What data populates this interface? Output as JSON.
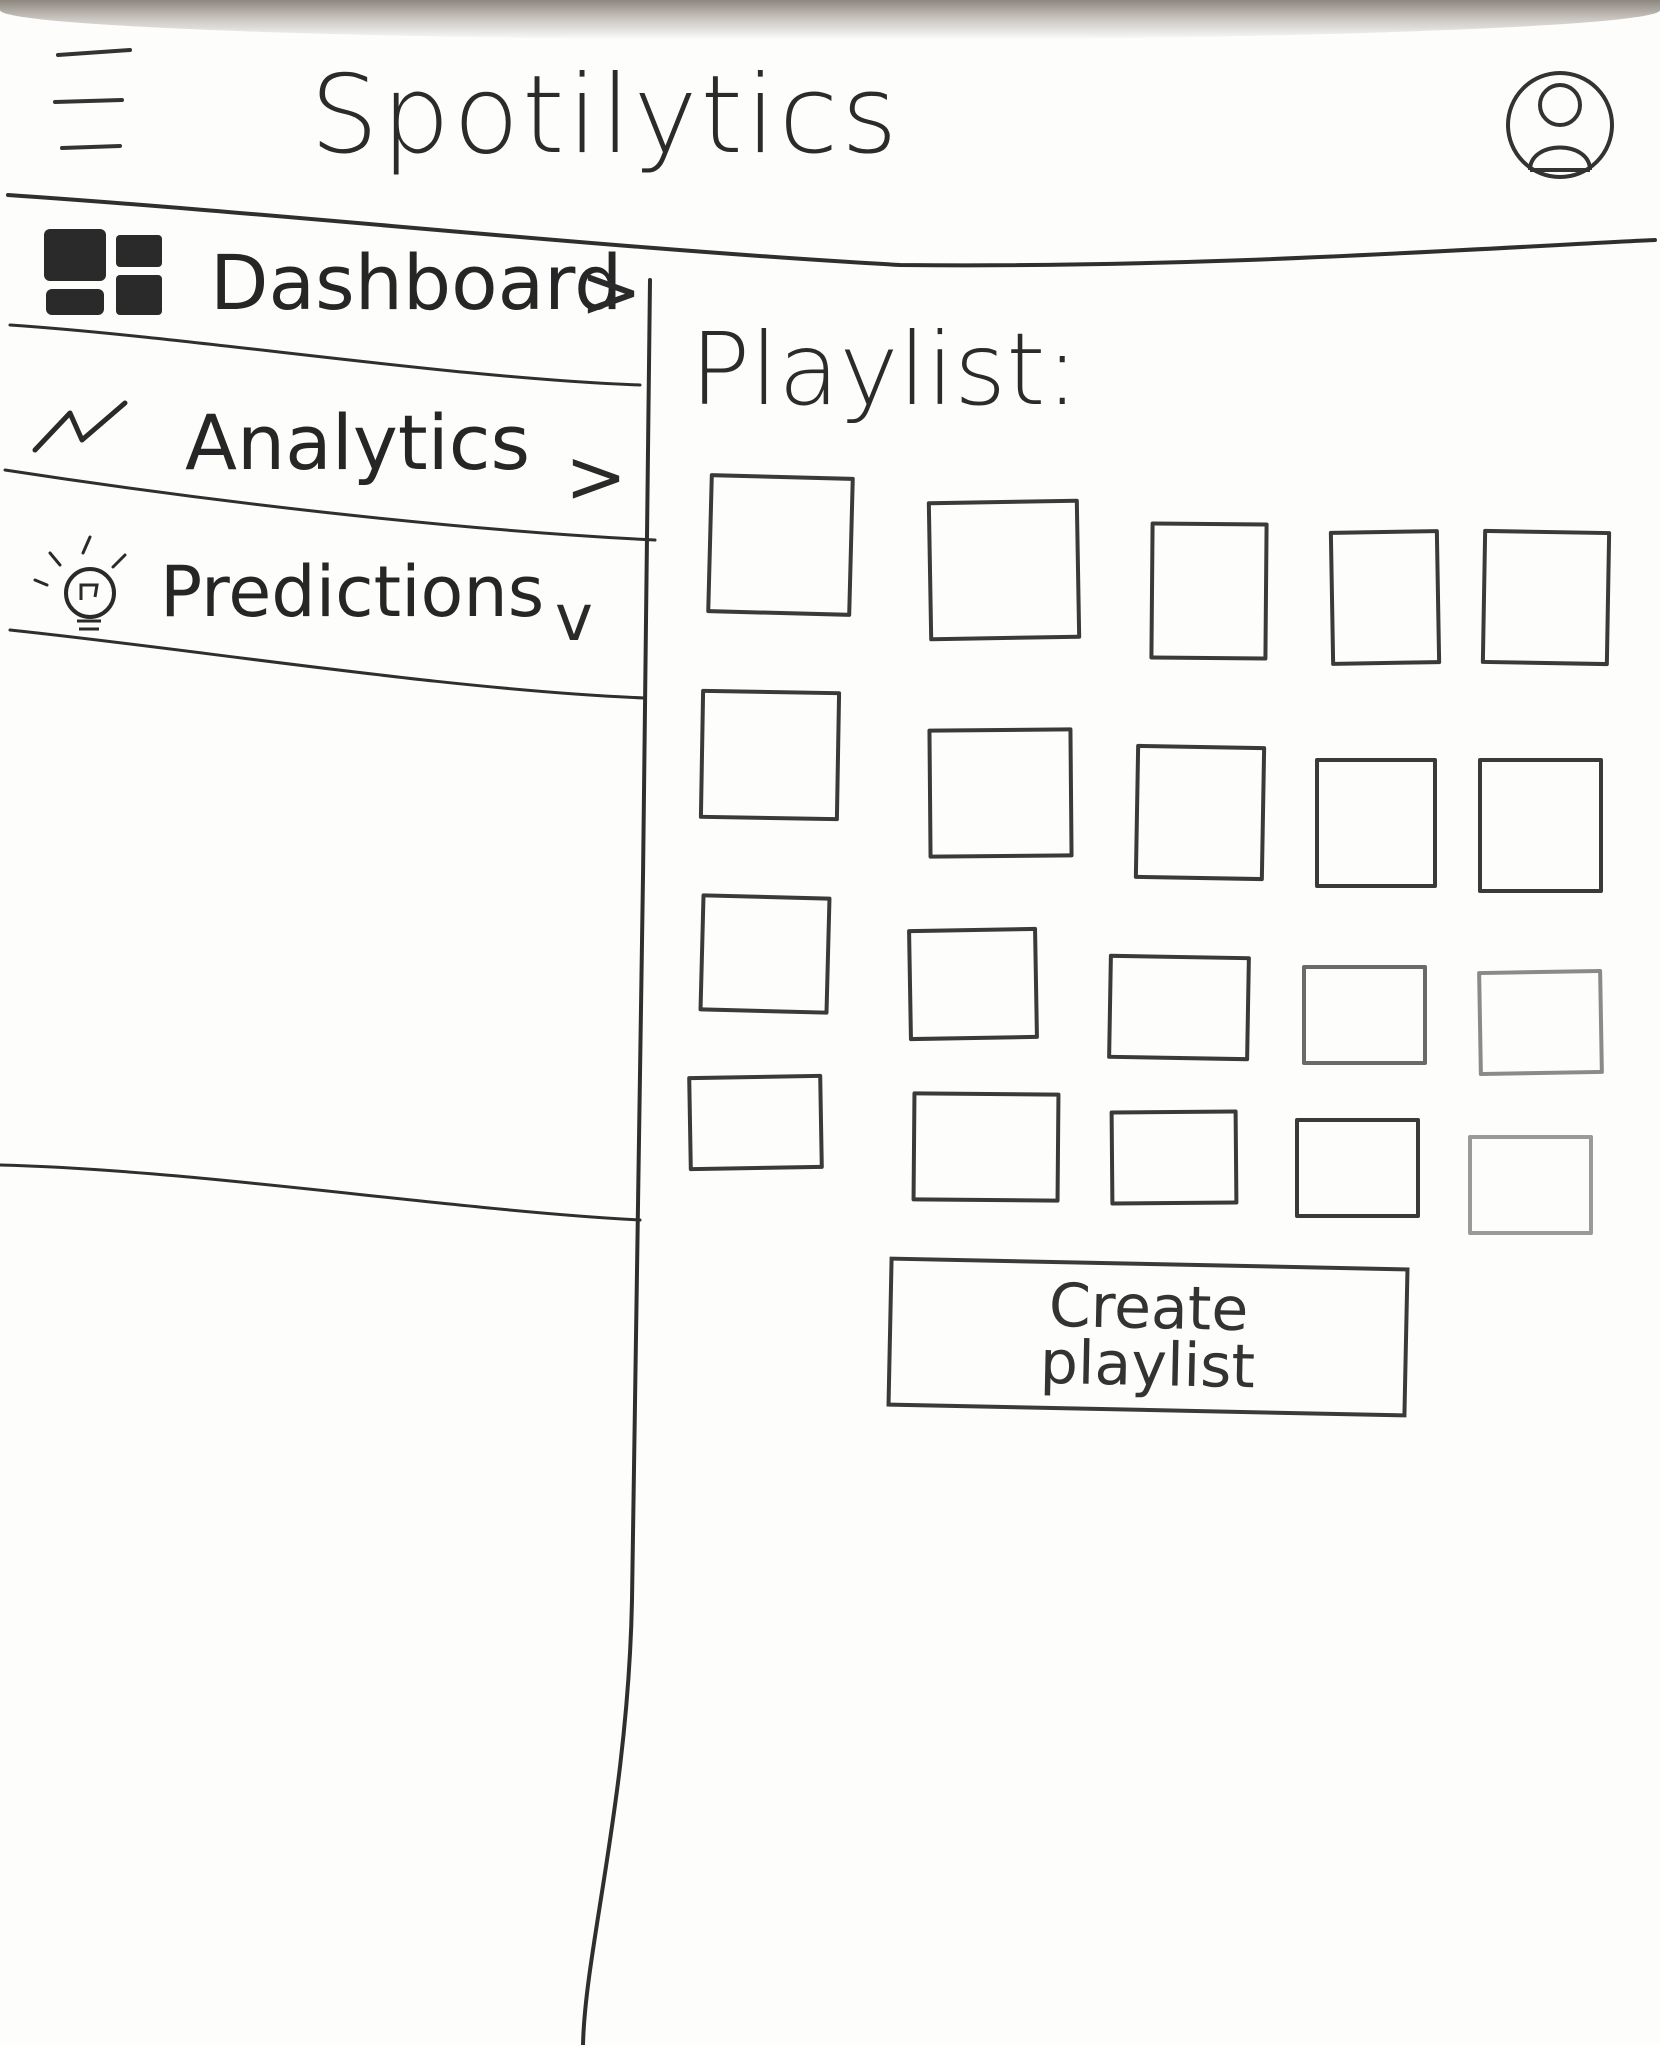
{
  "app": {
    "title": "Spotilytics"
  },
  "icons": {
    "menu": "hamburger-menu-icon",
    "profile": "user-avatar-icon",
    "dashboard": "dashboard-grid-icon",
    "analytics": "trend-line-icon",
    "predictions": "lightbulb-icon"
  },
  "sidebar": {
    "items": [
      {
        "label": "Dashboard",
        "chevron": ">"
      },
      {
        "label": "Analytics",
        "chevron": ">"
      },
      {
        "label": "Predictions",
        "chevron": "v"
      }
    ]
  },
  "main": {
    "title": "Playlist:",
    "playlist_rows": 4,
    "playlist_columns": 5,
    "create_button_label": "Create playlist"
  },
  "colors": {
    "ink": "#2f2f2f",
    "paper": "#fdfdfc"
  }
}
